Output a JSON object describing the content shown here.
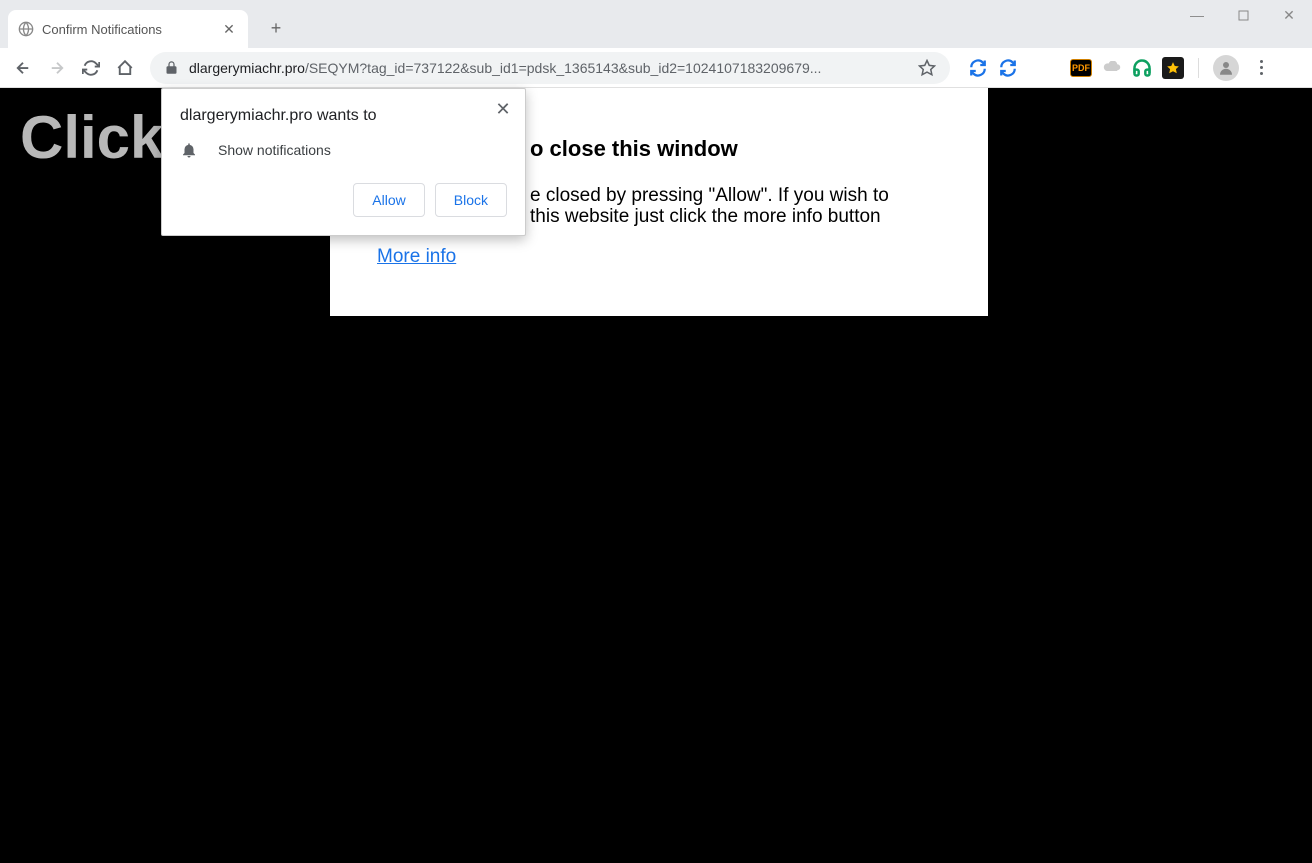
{
  "window": {
    "minimize": "—",
    "maximize": "☐",
    "close": "✕"
  },
  "tab": {
    "title": "Confirm Notifications"
  },
  "omnibox": {
    "domain": "dlargerymiachr.pro",
    "path": "/SEQYM?tag_id=737122&sub_id1=pdsk_1365143&sub_id2=1024107183209679..."
  },
  "page": {
    "background_text": "Click                                                                     u are not a",
    "modal_title_fragment": "o close this window",
    "modal_body_line1": "e closed by pressing \"Allow\". If you wish to",
    "modal_body_line2": "this website just click the more info button",
    "more_info": "More info"
  },
  "permission": {
    "title": "dlargerymiachr.pro wants to",
    "request": "Show notifications",
    "allow": "Allow",
    "block": "Block"
  }
}
